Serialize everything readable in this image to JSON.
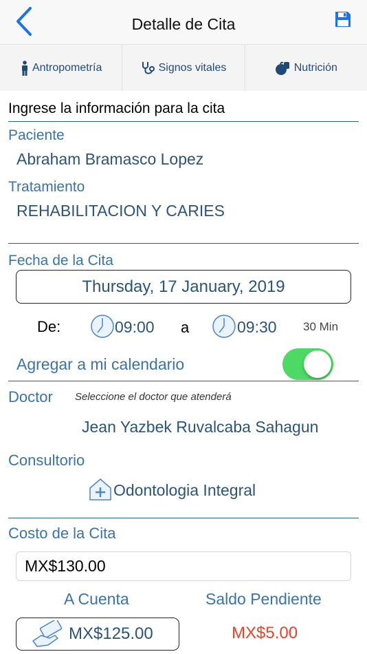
{
  "navbar": {
    "title": "Detalle de Cita",
    "back_icon": "chevron-left-icon",
    "save_icon": "floppy-disk-icon"
  },
  "tabs": [
    {
      "label": "Antropometría",
      "icon": "person-icon"
    },
    {
      "label": "Signos vitales",
      "icon": "stethoscope-icon"
    },
    {
      "label": "Nutrición",
      "icon": "food-icon"
    }
  ],
  "form": {
    "intro": "Ingrese la información para la cita",
    "patient_label": "Paciente",
    "patient_name": "Abraham Bramasco Lopez",
    "treatment_label": "Tratamiento",
    "treatment_value": "REHABILITACION Y CARIES",
    "date_label": "Fecha de la Cita",
    "date_value": "Thursday, 17 January, 2019",
    "from_label": "De:",
    "start_time": "09:00",
    "to_label": "a",
    "end_time": "09:30",
    "duration": "30 Min",
    "calendar_label": "Agregar a mi calendario",
    "calendar_enabled": true,
    "doctor_label": "Doctor",
    "doctor_hint": "Seleccione el doctor que atenderá",
    "doctor_name": "Jean Yazbek Ruvalcaba Sahagun",
    "office_label": "Consultorio",
    "office_name": "Odontologia Integral",
    "cost_label": "Costo de la Cita",
    "cost_value": "MX$130.00",
    "paid_label": "A Cuenta",
    "balance_label": "Saldo Pendiente",
    "paid_value": "MX$125.00",
    "balance_value": "MX$5.00"
  },
  "colors": {
    "accent": "#1a73e8",
    "label": "#3a73a8",
    "value": "#2b5478",
    "toggle_on": "#4cd964",
    "balance": "#e8442b"
  }
}
